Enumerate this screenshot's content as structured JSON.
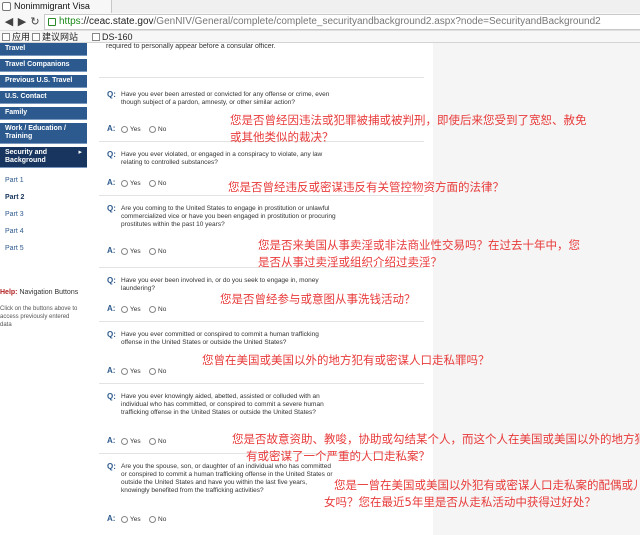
{
  "browser": {
    "tab_title": "Nonimmigrant Visa",
    "url_https": "https",
    "url_host": "://ceac.state.gov",
    "url_rest": "/GenNIV/General/complete/complete_securityandbackground2.aspx?node=SecurityandBackground2",
    "bookmarks": [
      "应用",
      "建议网站",
      "DS-160"
    ]
  },
  "sidebar": {
    "items": [
      "Travel",
      "Travel Companions",
      "Previous U.S. Travel",
      "U.S. Contact",
      "Family",
      "Work / Education / Training"
    ],
    "active_item_line1": "Security and",
    "active_item_line2": "Background",
    "active_arrow": "▸",
    "parts": [
      "Part 1",
      "Part 2",
      "Part 3",
      "Part 4",
      "Part 5"
    ],
    "help_label": "Help:",
    "help_title": "Navigation Buttons",
    "help_text": "Click on the buttons above to access previously entered data"
  },
  "form": {
    "top_text": "required to personally appear before a consular officer.",
    "q_letter": "Q:",
    "a_letter": "A:",
    "yes_label": "Yes",
    "no_label": "No",
    "questions": [
      "Have you ever been arrested or convicted for any offense or crime, even though subject of a pardon, amnesty, or other similar action?",
      "Have you ever violated, or engaged in a conspiracy to violate, any law relating to controlled substances?",
      "Are you coming to the United States to engage in prostitution or unlawful commercialized vice or have you been engaged in prostitution or procuring prostitutes within the past 10 years?",
      "Have you ever been involved in, or do you seek to engage in, money laundering?",
      "Have you ever committed or conspired to commit a human trafficking offense in the United States or outside the United States?",
      "Have you ever knowingly aided, abetted, assisted or colluded with an individual who has committed, or conspired to commit a severe human trafficking offense in the United States or outside the United States?",
      "Are you the spouse, son, or daughter of an individual who has committed or conspired to commit a human trafficking offense in the United States or outside the United States and have you within the last five years, knowingly benefited from the trafficking activities?"
    ]
  },
  "annotations": [
    [
      "您是否曾经因违法或犯罪被捕或被判刑，即使后来您受到了宽恕、赦免",
      "或其他类似的裁决？"
    ],
    [
      "您是否曾经违反或密谋违反有关管控物资方面的法律？"
    ],
    [
      "您是否来美国从事卖淫或非法商业性交易吗？在过去十年中，您",
      "是否从事过卖淫或组织介绍过卖淫？"
    ],
    [
      "您是否曾经参与或意图从事洗钱活动？"
    ],
    [
      "您曾在美国或美国以外的地方犯有或密谋人口走私罪吗？"
    ],
    [
      "您是否故意资助、教唆，协助或勾结某个人，而这个人在美国或美国以外的地方犯",
      "有或密谋了一个严重的人口走私案？"
    ],
    [
      "您是一曾在美国或美国以外犯有或密谋人口走私案的配偶或儿",
      "女吗？您在最近5年里是否从走私活动中获得过好处？"
    ]
  ],
  "colors": {
    "sidebar_bg": "#2d5a8e",
    "sidebar_active": "#17355e",
    "annotation": "#e83a3a"
  }
}
